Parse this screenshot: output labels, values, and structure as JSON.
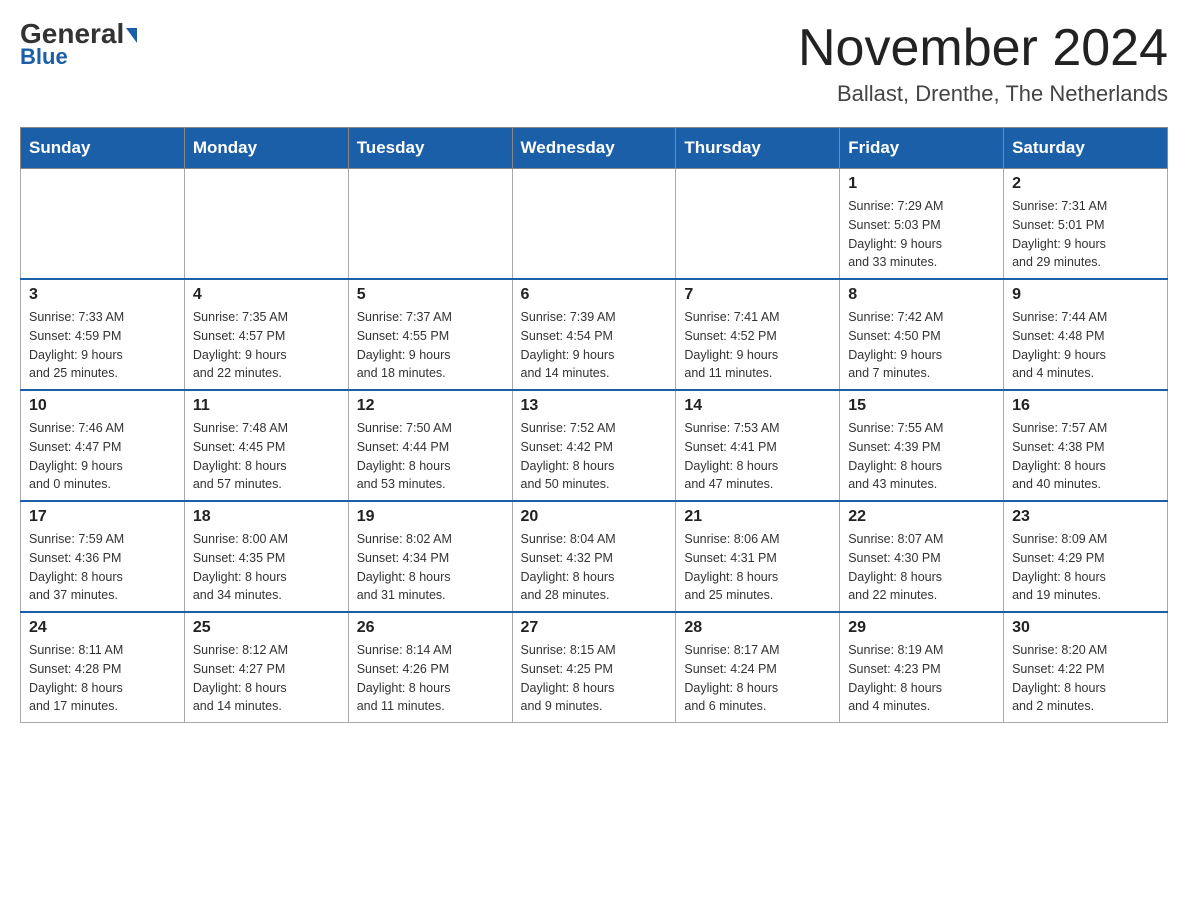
{
  "header": {
    "logo_main": "General",
    "logo_sub": "Blue",
    "month_title": "November 2024",
    "location": "Ballast, Drenthe, The Netherlands"
  },
  "weekdays": [
    "Sunday",
    "Monday",
    "Tuesday",
    "Wednesday",
    "Thursday",
    "Friday",
    "Saturday"
  ],
  "weeks": [
    [
      {
        "day": "",
        "info": ""
      },
      {
        "day": "",
        "info": ""
      },
      {
        "day": "",
        "info": ""
      },
      {
        "day": "",
        "info": ""
      },
      {
        "day": "",
        "info": ""
      },
      {
        "day": "1",
        "info": "Sunrise: 7:29 AM\nSunset: 5:03 PM\nDaylight: 9 hours\nand 33 minutes."
      },
      {
        "day": "2",
        "info": "Sunrise: 7:31 AM\nSunset: 5:01 PM\nDaylight: 9 hours\nand 29 minutes."
      }
    ],
    [
      {
        "day": "3",
        "info": "Sunrise: 7:33 AM\nSunset: 4:59 PM\nDaylight: 9 hours\nand 25 minutes."
      },
      {
        "day": "4",
        "info": "Sunrise: 7:35 AM\nSunset: 4:57 PM\nDaylight: 9 hours\nand 22 minutes."
      },
      {
        "day": "5",
        "info": "Sunrise: 7:37 AM\nSunset: 4:55 PM\nDaylight: 9 hours\nand 18 minutes."
      },
      {
        "day": "6",
        "info": "Sunrise: 7:39 AM\nSunset: 4:54 PM\nDaylight: 9 hours\nand 14 minutes."
      },
      {
        "day": "7",
        "info": "Sunrise: 7:41 AM\nSunset: 4:52 PM\nDaylight: 9 hours\nand 11 minutes."
      },
      {
        "day": "8",
        "info": "Sunrise: 7:42 AM\nSunset: 4:50 PM\nDaylight: 9 hours\nand 7 minutes."
      },
      {
        "day": "9",
        "info": "Sunrise: 7:44 AM\nSunset: 4:48 PM\nDaylight: 9 hours\nand 4 minutes."
      }
    ],
    [
      {
        "day": "10",
        "info": "Sunrise: 7:46 AM\nSunset: 4:47 PM\nDaylight: 9 hours\nand 0 minutes."
      },
      {
        "day": "11",
        "info": "Sunrise: 7:48 AM\nSunset: 4:45 PM\nDaylight: 8 hours\nand 57 minutes."
      },
      {
        "day": "12",
        "info": "Sunrise: 7:50 AM\nSunset: 4:44 PM\nDaylight: 8 hours\nand 53 minutes."
      },
      {
        "day": "13",
        "info": "Sunrise: 7:52 AM\nSunset: 4:42 PM\nDaylight: 8 hours\nand 50 minutes."
      },
      {
        "day": "14",
        "info": "Sunrise: 7:53 AM\nSunset: 4:41 PM\nDaylight: 8 hours\nand 47 minutes."
      },
      {
        "day": "15",
        "info": "Sunrise: 7:55 AM\nSunset: 4:39 PM\nDaylight: 8 hours\nand 43 minutes."
      },
      {
        "day": "16",
        "info": "Sunrise: 7:57 AM\nSunset: 4:38 PM\nDaylight: 8 hours\nand 40 minutes."
      }
    ],
    [
      {
        "day": "17",
        "info": "Sunrise: 7:59 AM\nSunset: 4:36 PM\nDaylight: 8 hours\nand 37 minutes."
      },
      {
        "day": "18",
        "info": "Sunrise: 8:00 AM\nSunset: 4:35 PM\nDaylight: 8 hours\nand 34 minutes."
      },
      {
        "day": "19",
        "info": "Sunrise: 8:02 AM\nSunset: 4:34 PM\nDaylight: 8 hours\nand 31 minutes."
      },
      {
        "day": "20",
        "info": "Sunrise: 8:04 AM\nSunset: 4:32 PM\nDaylight: 8 hours\nand 28 minutes."
      },
      {
        "day": "21",
        "info": "Sunrise: 8:06 AM\nSunset: 4:31 PM\nDaylight: 8 hours\nand 25 minutes."
      },
      {
        "day": "22",
        "info": "Sunrise: 8:07 AM\nSunset: 4:30 PM\nDaylight: 8 hours\nand 22 minutes."
      },
      {
        "day": "23",
        "info": "Sunrise: 8:09 AM\nSunset: 4:29 PM\nDaylight: 8 hours\nand 19 minutes."
      }
    ],
    [
      {
        "day": "24",
        "info": "Sunrise: 8:11 AM\nSunset: 4:28 PM\nDaylight: 8 hours\nand 17 minutes."
      },
      {
        "day": "25",
        "info": "Sunrise: 8:12 AM\nSunset: 4:27 PM\nDaylight: 8 hours\nand 14 minutes."
      },
      {
        "day": "26",
        "info": "Sunrise: 8:14 AM\nSunset: 4:26 PM\nDaylight: 8 hours\nand 11 minutes."
      },
      {
        "day": "27",
        "info": "Sunrise: 8:15 AM\nSunset: 4:25 PM\nDaylight: 8 hours\nand 9 minutes."
      },
      {
        "day": "28",
        "info": "Sunrise: 8:17 AM\nSunset: 4:24 PM\nDaylight: 8 hours\nand 6 minutes."
      },
      {
        "day": "29",
        "info": "Sunrise: 8:19 AM\nSunset: 4:23 PM\nDaylight: 8 hours\nand 4 minutes."
      },
      {
        "day": "30",
        "info": "Sunrise: 8:20 AM\nSunset: 4:22 PM\nDaylight: 8 hours\nand 2 minutes."
      }
    ]
  ]
}
